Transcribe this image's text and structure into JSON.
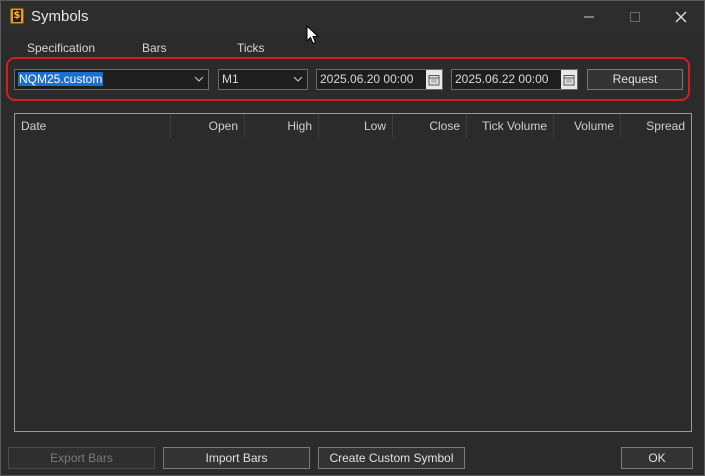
{
  "window": {
    "title": "Symbols"
  },
  "tabs": [
    {
      "label": "Specification"
    },
    {
      "label": "Bars",
      "active": true
    },
    {
      "label": "Ticks"
    }
  ],
  "filters": {
    "symbol": "NQM25.custom",
    "timeframe": "M1",
    "date_from": "2025.06.20 00:00",
    "date_to": "2025.06.22 00:00",
    "request_label": "Request"
  },
  "table": {
    "columns": [
      "Date",
      "Open",
      "High",
      "Low",
      "Close",
      "Tick Volume",
      "Volume",
      "Spread"
    ],
    "rows": []
  },
  "footer": {
    "export_label": "Export Bars",
    "import_label": "Import Bars",
    "create_label": "Create Custom Symbol",
    "ok_label": "OK"
  },
  "colors": {
    "background": "#2b2b2b",
    "highlight": "#d11f1f",
    "selection": "#1a6fd0",
    "active_tab": "#e07020"
  }
}
